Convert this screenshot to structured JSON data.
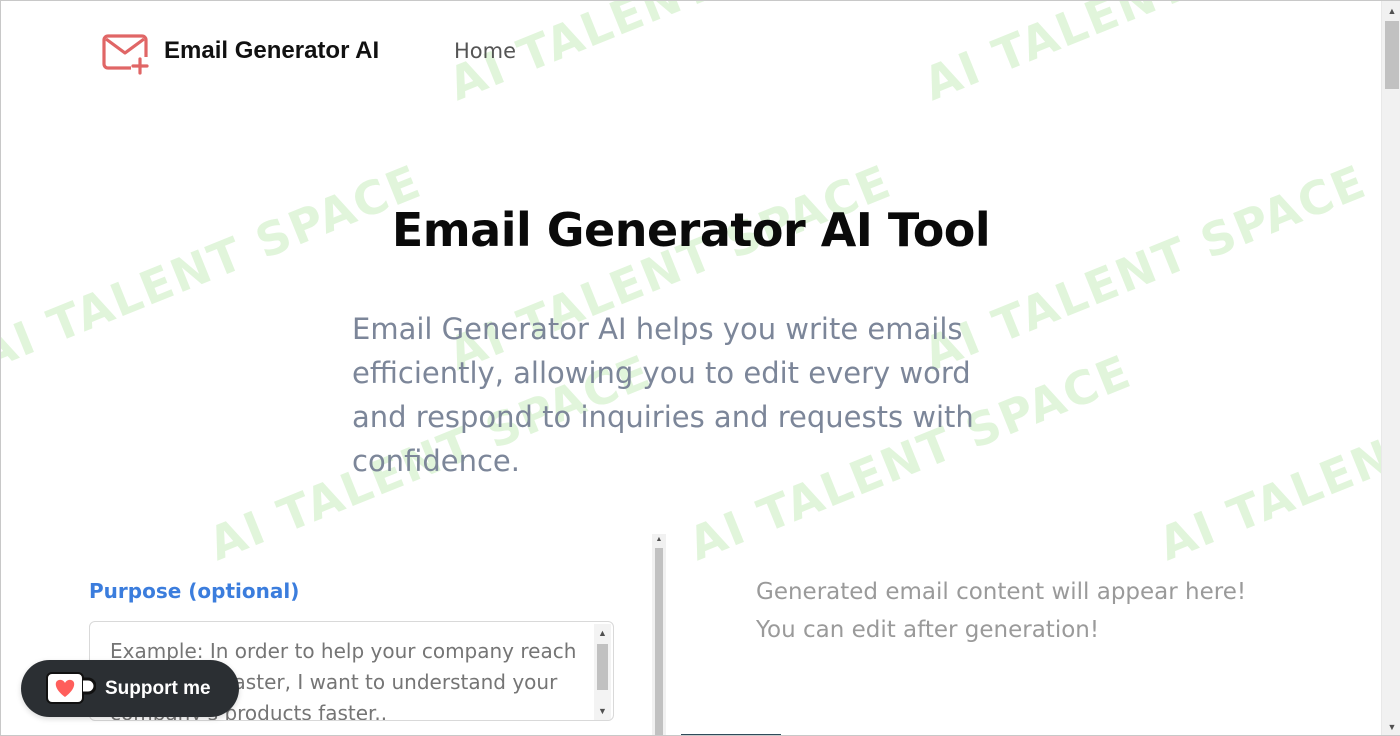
{
  "header": {
    "brand": "Email Generator AI",
    "nav": {
      "home": "Home"
    }
  },
  "watermark": {
    "text": "AI TALENT SPACE",
    "color": "#d7f2cf"
  },
  "hero": {
    "title": "Email Generator AI Tool",
    "description": "Email Generator AI helps you write emails efficiently, allowing you to edit every word and respond to inquiries and requests with confidence."
  },
  "form": {
    "purpose_label": "Purpose (optional)",
    "purpose_placeholder": "Example: In order to help your company reach the market faster, I want to understand your company's products faster.."
  },
  "output": {
    "placeholder": "Generated email content will appear here! You can edit after generation!"
  },
  "support": {
    "label": "Support me"
  },
  "colors": {
    "accent": "#3b7ddd",
    "logo": "#e06666",
    "support_bg": "#2b2f33"
  }
}
